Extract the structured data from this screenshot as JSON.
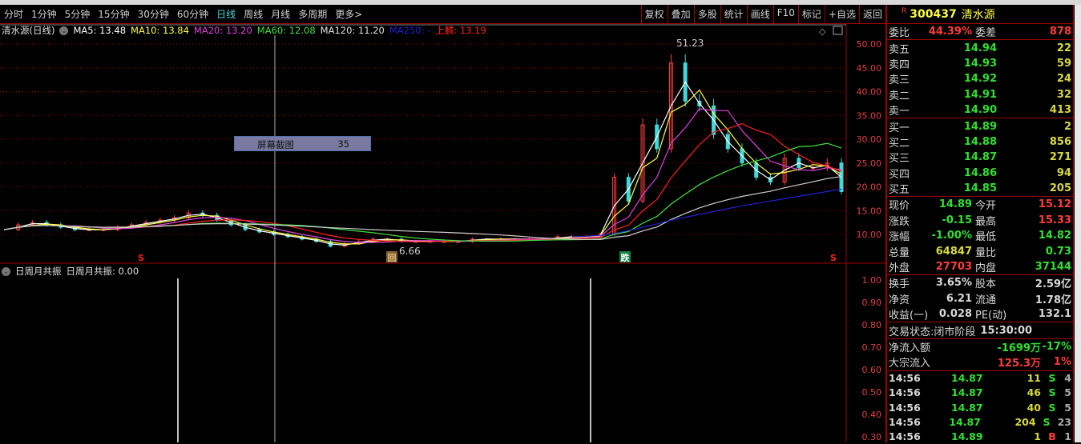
{
  "toolbar": {
    "periods": [
      "分时",
      "1分钟",
      "5分钟",
      "15分钟",
      "30分钟",
      "60分钟",
      "日线",
      "周线",
      "月线",
      "多周期",
      "更多>"
    ],
    "active": "日线",
    "tools": [
      "复权",
      "叠加",
      "多股",
      "统计",
      "画线",
      "F10",
      "标记",
      "+自选",
      "返回"
    ]
  },
  "legend": {
    "title": "清水源(日线)",
    "ma5": "MA5: 13.48",
    "ma10": "MA10: 13.84",
    "ma20": "MA20: 13.20",
    "ma60": "MA60: 12.08",
    "ma120": "MA120: 11.20",
    "ma250": "MA250: -",
    "shanglin": "上麟: 13.19"
  },
  "colors": {
    "ma5": "#ffffff",
    "ma10": "#ffff40",
    "ma20": "#e040e0",
    "ma60": "#40e040",
    "ma120": "#d0d0d0",
    "ma250": "#2020d0",
    "shanglin": "#ff2020",
    "up": "#ff4040",
    "down": "#40d8d8"
  },
  "chart_data": {
    "type": "line",
    "ylim": [
      5,
      55
    ],
    "yticks": [
      "50.00",
      "45.00",
      "40.00",
      "35.00",
      "30.00",
      "25.00",
      "20.00",
      "15.00",
      "10.00"
    ],
    "close": [
      11,
      12,
      12.5,
      12,
      11.5,
      11,
      11,
      11,
      11.5,
      12,
      12.5,
      13,
      13.5,
      14.5,
      14,
      13,
      12,
      11,
      10.5,
      10,
      9.5,
      9,
      8.5,
      7.5,
      8,
      8.5,
      9,
      9,
      8.5,
      8.5,
      8.5,
      8.5,
      8.5,
      9,
      9,
      9,
      9,
      9,
      9,
      9.5,
      9.5,
      9.5,
      10,
      22,
      17,
      33,
      28,
      46,
      38,
      37,
      31,
      28,
      25,
      22,
      21,
      26,
      24,
      24,
      25,
      19
    ],
    "ma250": [
      null,
      null,
      null,
      null,
      null,
      null,
      null,
      null,
      null,
      null,
      null,
      null,
      null,
      null,
      null,
      null,
      null,
      null,
      null,
      null,
      null,
      null,
      null,
      null,
      null,
      null,
      null,
      null,
      null,
      null,
      null,
      null,
      null,
      null,
      null,
      null,
      null,
      null,
      null,
      null,
      9.5,
      9.6,
      9.8,
      10.2,
      10.8,
      11.5,
      12.2,
      13,
      13.6,
      14.2,
      14.8,
      15.4,
      16,
      16.5,
      17,
      17.5,
      18,
      18.5,
      19,
      19.5
    ],
    "high_label": "51.23",
    "low_label": "6.66",
    "markers": [
      "S",
      "回",
      "跌",
      "S"
    ]
  },
  "popup": {
    "label": "屏幕截图",
    "value": "35"
  },
  "lower": {
    "title": "日周月共振",
    "value_label": "日周月共振: 0.00",
    "yticks": [
      "1.00",
      "0.90",
      "0.80",
      "0.70",
      "0.60",
      "0.50",
      "0.40",
      "0.30"
    ]
  },
  "quote": {
    "code": "300437",
    "name": "清水源",
    "badge": "R",
    "weibi": {
      "label": "委比",
      "value": "44.39%",
      "label2": "委差",
      "value2": "878"
    },
    "sell": [
      {
        "label": "卖五",
        "price": "14.94",
        "vol": "22"
      },
      {
        "label": "卖四",
        "price": "14.93",
        "vol": "59"
      },
      {
        "label": "卖三",
        "price": "14.92",
        "vol": "24"
      },
      {
        "label": "卖二",
        "price": "14.91",
        "vol": "32"
      },
      {
        "label": "卖一",
        "price": "14.90",
        "vol": "413"
      }
    ],
    "buy": [
      {
        "label": "买一",
        "price": "14.89",
        "vol": "2"
      },
      {
        "label": "买二",
        "price": "14.88",
        "vol": "856"
      },
      {
        "label": "买三",
        "price": "14.87",
        "vol": "271"
      },
      {
        "label": "买四",
        "price": "14.86",
        "vol": "94"
      },
      {
        "label": "买五",
        "price": "14.85",
        "vol": "205"
      }
    ],
    "stats": [
      [
        "现价",
        "14.89",
        "今开",
        "15.12"
      ],
      [
        "涨跌",
        "-0.15",
        "最高",
        "15.33"
      ],
      [
        "涨幅",
        "-1.00%",
        "最低",
        "14.82"
      ],
      [
        "总量",
        "64847",
        "量比",
        "0.73"
      ],
      [
        "外盘",
        "27703",
        "内盘",
        "37144"
      ]
    ],
    "fund": [
      [
        "换手",
        "3.65%",
        "股本",
        "2.59亿"
      ],
      [
        "净资",
        "6.21",
        "流通",
        "1.78亿"
      ],
      [
        "收益(一)",
        "0.028",
        "PE(动)",
        "132.1"
      ]
    ],
    "status": {
      "label": "交易状态:",
      "phase": "闭市阶段",
      "time": "15:30:00"
    },
    "flow": [
      [
        "净流入额",
        "-1699万",
        "-17%"
      ],
      [
        "大宗流入",
        "125.3万",
        "1%"
      ]
    ],
    "ticks": [
      [
        "14:56",
        "14.87",
        "11",
        "S",
        "4"
      ],
      [
        "14:56",
        "14.87",
        "46",
        "S",
        "5"
      ],
      [
        "14:56",
        "14.87",
        "40",
        "S",
        "5"
      ],
      [
        "14:56",
        "14.87",
        "204",
        "S",
        "23"
      ],
      [
        "14:56",
        "14.89",
        "1",
        "B",
        "1"
      ]
    ]
  }
}
